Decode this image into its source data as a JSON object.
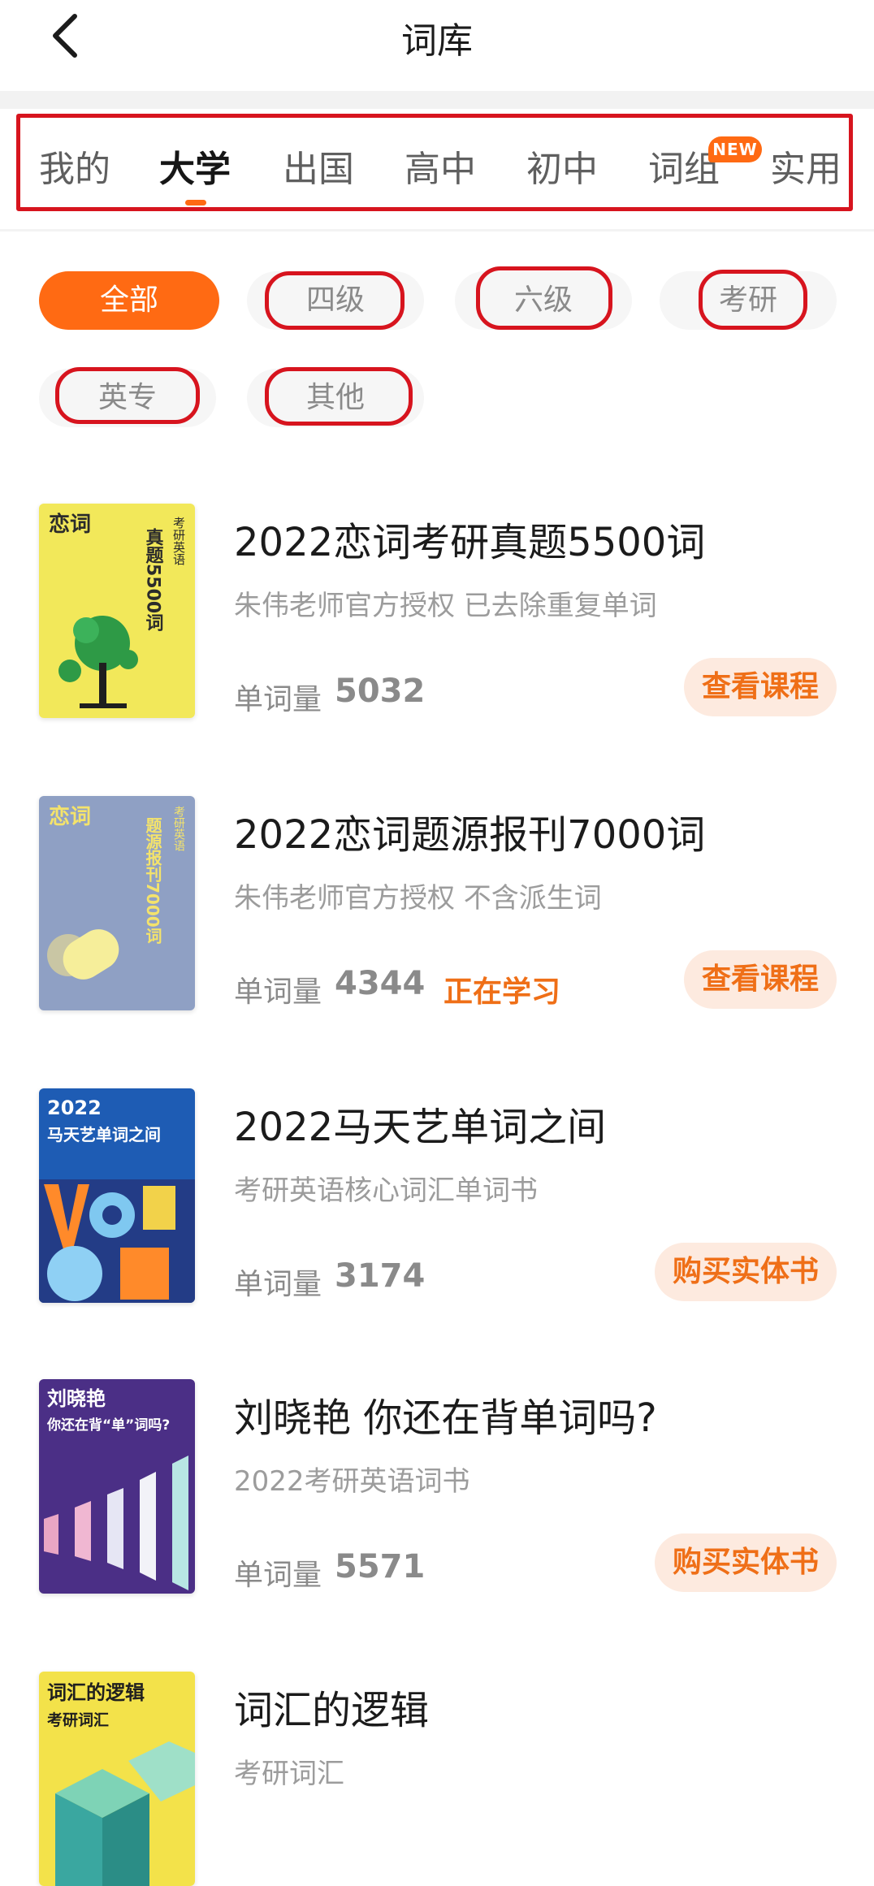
{
  "header": {
    "title": "词库",
    "back_icon": "chevron-left-icon"
  },
  "tabs": [
    {
      "label": "我的",
      "active": false
    },
    {
      "label": "大学",
      "active": true
    },
    {
      "label": "出国",
      "active": false
    },
    {
      "label": "高中",
      "active": false
    },
    {
      "label": "初中",
      "active": false
    },
    {
      "label": "词组",
      "active": false,
      "badge": "NEW"
    },
    {
      "label": "实用",
      "active": false
    }
  ],
  "filters": [
    {
      "label": "全部",
      "active": true
    },
    {
      "label": "四级",
      "active": false
    },
    {
      "label": "六级",
      "active": false
    },
    {
      "label": "考研",
      "active": false
    },
    {
      "label": "英专",
      "active": false
    },
    {
      "label": "其他",
      "active": false
    }
  ],
  "books": [
    {
      "title": "2022恋词考研真题5500词",
      "desc": "朱伟老师官方授权 已去除重复单词",
      "word_label": "单词量",
      "word_count": "5032",
      "status": "",
      "action": "查看课程",
      "cover": {
        "brand": "恋词",
        "vertical_main": "真题5500词",
        "vertical_side": "考研英语",
        "bg": "#f2e85a"
      }
    },
    {
      "title": "2022恋词题源报刊7000词",
      "desc": "朱伟老师官方授权 不含派生词",
      "word_label": "单词量",
      "word_count": "4344",
      "status": "正在学习",
      "action": "查看课程",
      "cover": {
        "brand": "恋词",
        "vertical_main": "题源报刊7000词",
        "vertical_side": "考研英语",
        "bg": "#8fa0c4"
      }
    },
    {
      "title": "2022马天艺单词之间",
      "desc": "考研英语核心词汇单词书",
      "word_label": "单词量",
      "word_count": "3174",
      "status": "",
      "action": "购买实体书",
      "cover": {
        "line1": "2022",
        "line2": "马天艺单词之间",
        "bg": "#1e5cb4"
      }
    },
    {
      "title": "刘晓艳 你还在背单词吗?",
      "desc": "2022考研英语词书",
      "word_label": "单词量",
      "word_count": "5571",
      "status": "",
      "action": "购买实体书",
      "cover": {
        "line1": "刘晓艳",
        "line2": "你还在背“单”词吗?",
        "bg": "#4b2f86"
      }
    },
    {
      "title": "词汇的逻辑",
      "desc": "考研词汇",
      "word_label": "",
      "word_count": "",
      "status": "",
      "action": "",
      "cover": {
        "line1": "词汇的逻辑",
        "line2": "考研词汇",
        "bg": "#f3e24a"
      }
    }
  ],
  "colors": {
    "accent": "#ff6a13",
    "highlight_outline": "#d7141e",
    "action_text": "#ef6f17",
    "action_bg": "#fdeadf"
  }
}
